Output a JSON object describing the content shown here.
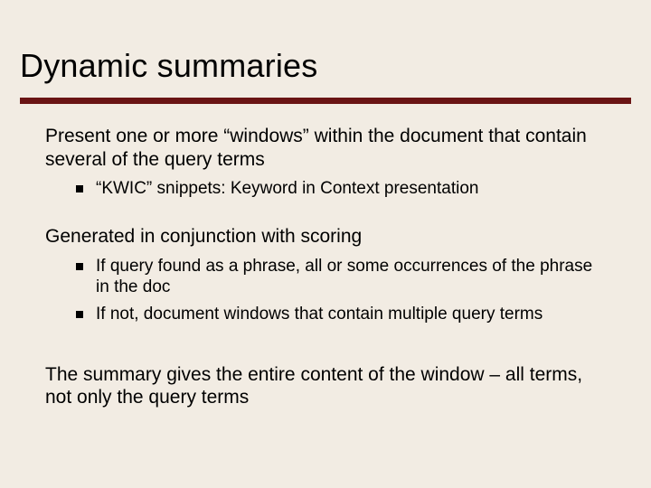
{
  "title": "Dynamic summaries",
  "para1": "Present one or more “windows” within the document that contain several of the query terms",
  "sub1": "“KWIC” snippets: Keyword in Context presentation",
  "para2": "Generated in conjunction with scoring",
  "sub2a": "If query found as a phrase, all or some occurrences of the phrase in the doc",
  "sub2b": "If not, document windows that contain multiple query terms",
  "para3": "The summary gives the entire content of the window – all terms, not only the query terms"
}
